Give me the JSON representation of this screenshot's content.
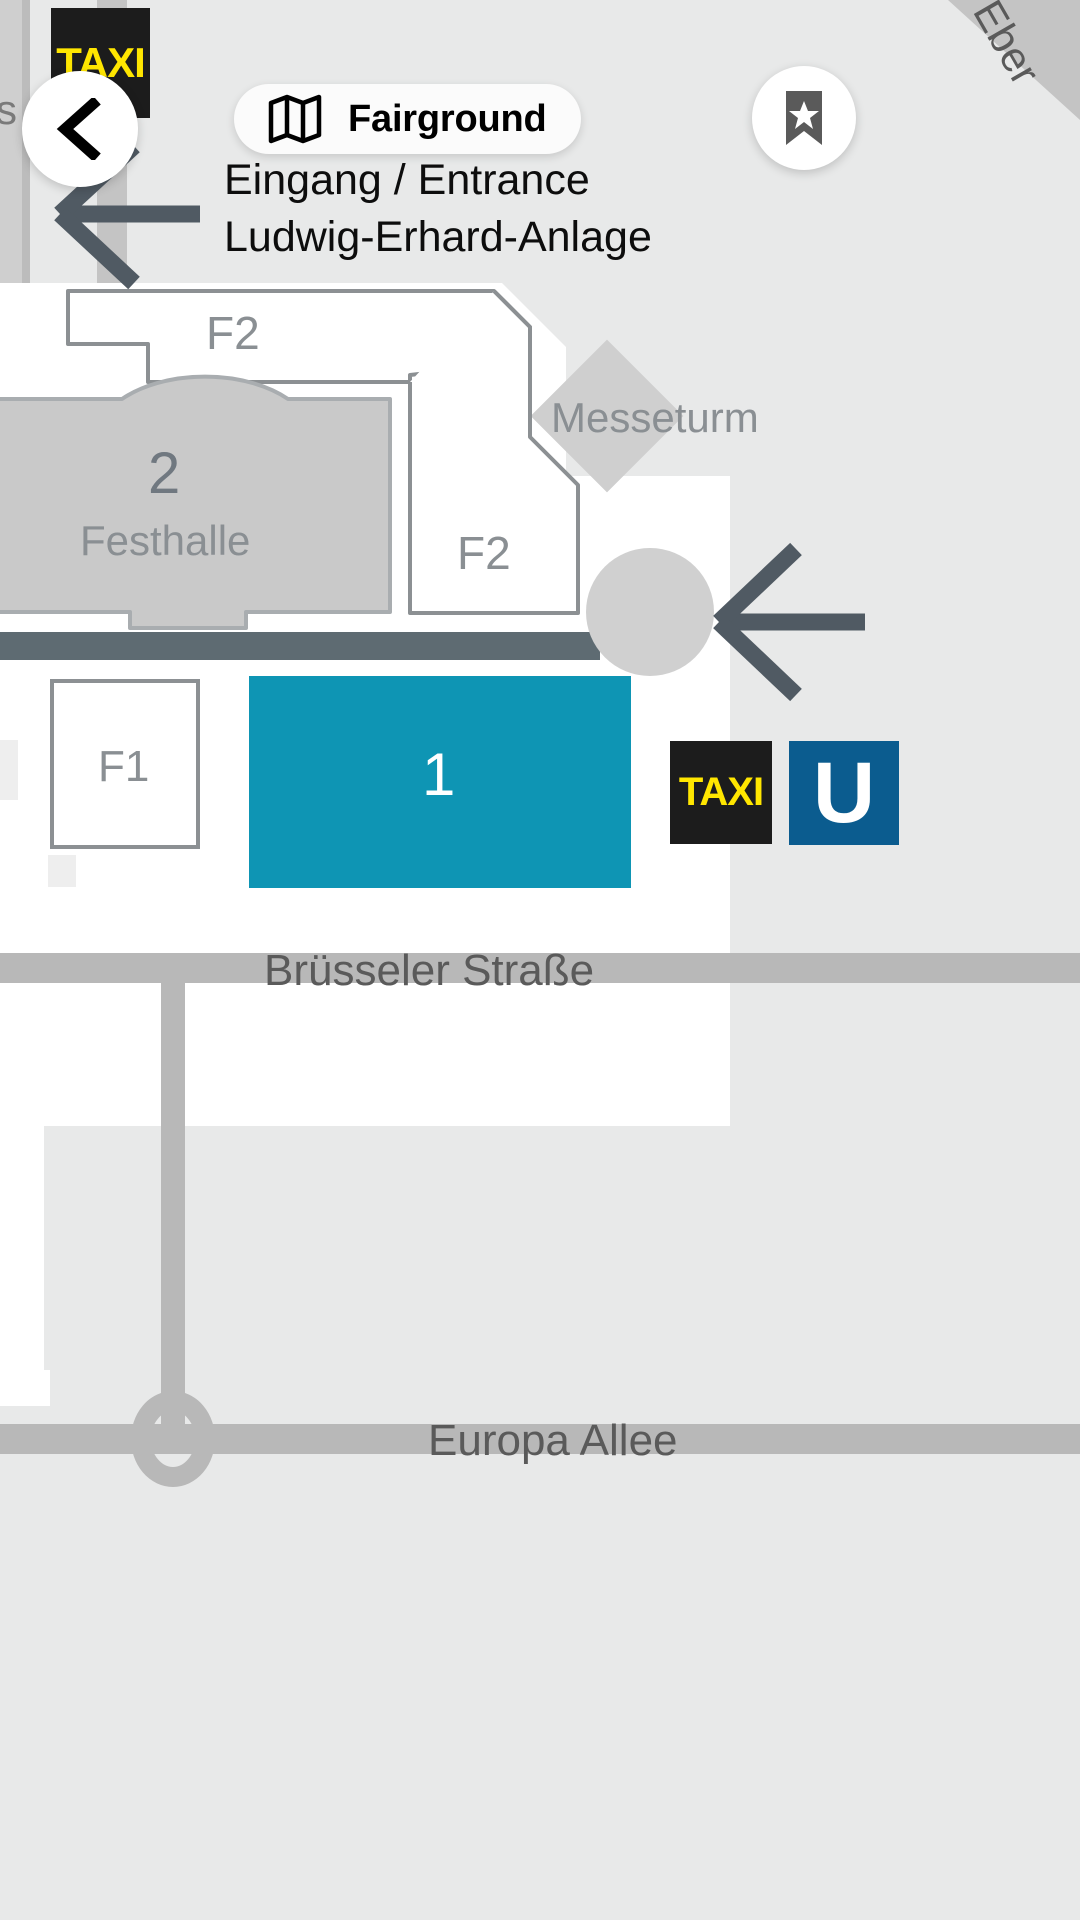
{
  "app": {
    "title": "Fairground"
  },
  "topbar": {
    "back_label": "Back",
    "back_icon": "chevron-left-icon",
    "map_icon": "map-fold-icon",
    "title": "Fairground",
    "bookmark_icon": "bookmark-star-icon"
  },
  "entrance": {
    "line1": "Eingang / Entrance",
    "line2": "Ludwig-Erhard-Anlage"
  },
  "map": {
    "buildings": [
      {
        "id": "hall-2",
        "label_number": "2",
        "label_name": "Festhalle",
        "fill": "#c9c9c9"
      },
      {
        "id": "hall-1",
        "label_number": "1",
        "label_name": "",
        "fill": "#0e95b4"
      },
      {
        "id": "f2-north",
        "label": "F2",
        "fill": "#ffffff"
      },
      {
        "id": "f2-south",
        "label": "F2",
        "fill": "#ffffff"
      },
      {
        "id": "f1",
        "label": "F1",
        "fill": "#ffffff"
      },
      {
        "id": "messeturm",
        "label": "Messeturm",
        "fill": "#cfcfcf"
      }
    ],
    "streets": [
      {
        "id": "bruesseler",
        "label": "Brüsseler Straße"
      },
      {
        "id": "europa-allee",
        "label": "Europa Allee"
      },
      {
        "id": "eberstrasse",
        "label": "Eber"
      },
      {
        "id": "left-strip",
        "label": "s"
      }
    ],
    "markers": [
      {
        "id": "taxi-top",
        "label": "TAXI",
        "bg": "#1c1c1c",
        "fg": "#ffe600"
      },
      {
        "id": "taxi-bottom",
        "label": "TAXI",
        "bg": "#1c1c1c",
        "fg": "#ffe600"
      },
      {
        "id": "ubahn",
        "label": "U",
        "bg": "#0b5c8f",
        "fg": "#ffffff"
      }
    ],
    "arrows": [
      {
        "id": "arrow-top-left",
        "direction": "left",
        "color": "#505a63"
      },
      {
        "id": "arrow-right",
        "direction": "left",
        "color": "#505a63"
      }
    ],
    "colors": {
      "background": "#e8e9e9",
      "plaza": "#ffffff",
      "building_gray": "#c9c9c9",
      "building_teal": "#0e95b4",
      "road": "#b8b8b8",
      "dark_road": "#5e6b72",
      "outline": "#8c9093",
      "label_gray": "#8a8f93"
    }
  }
}
